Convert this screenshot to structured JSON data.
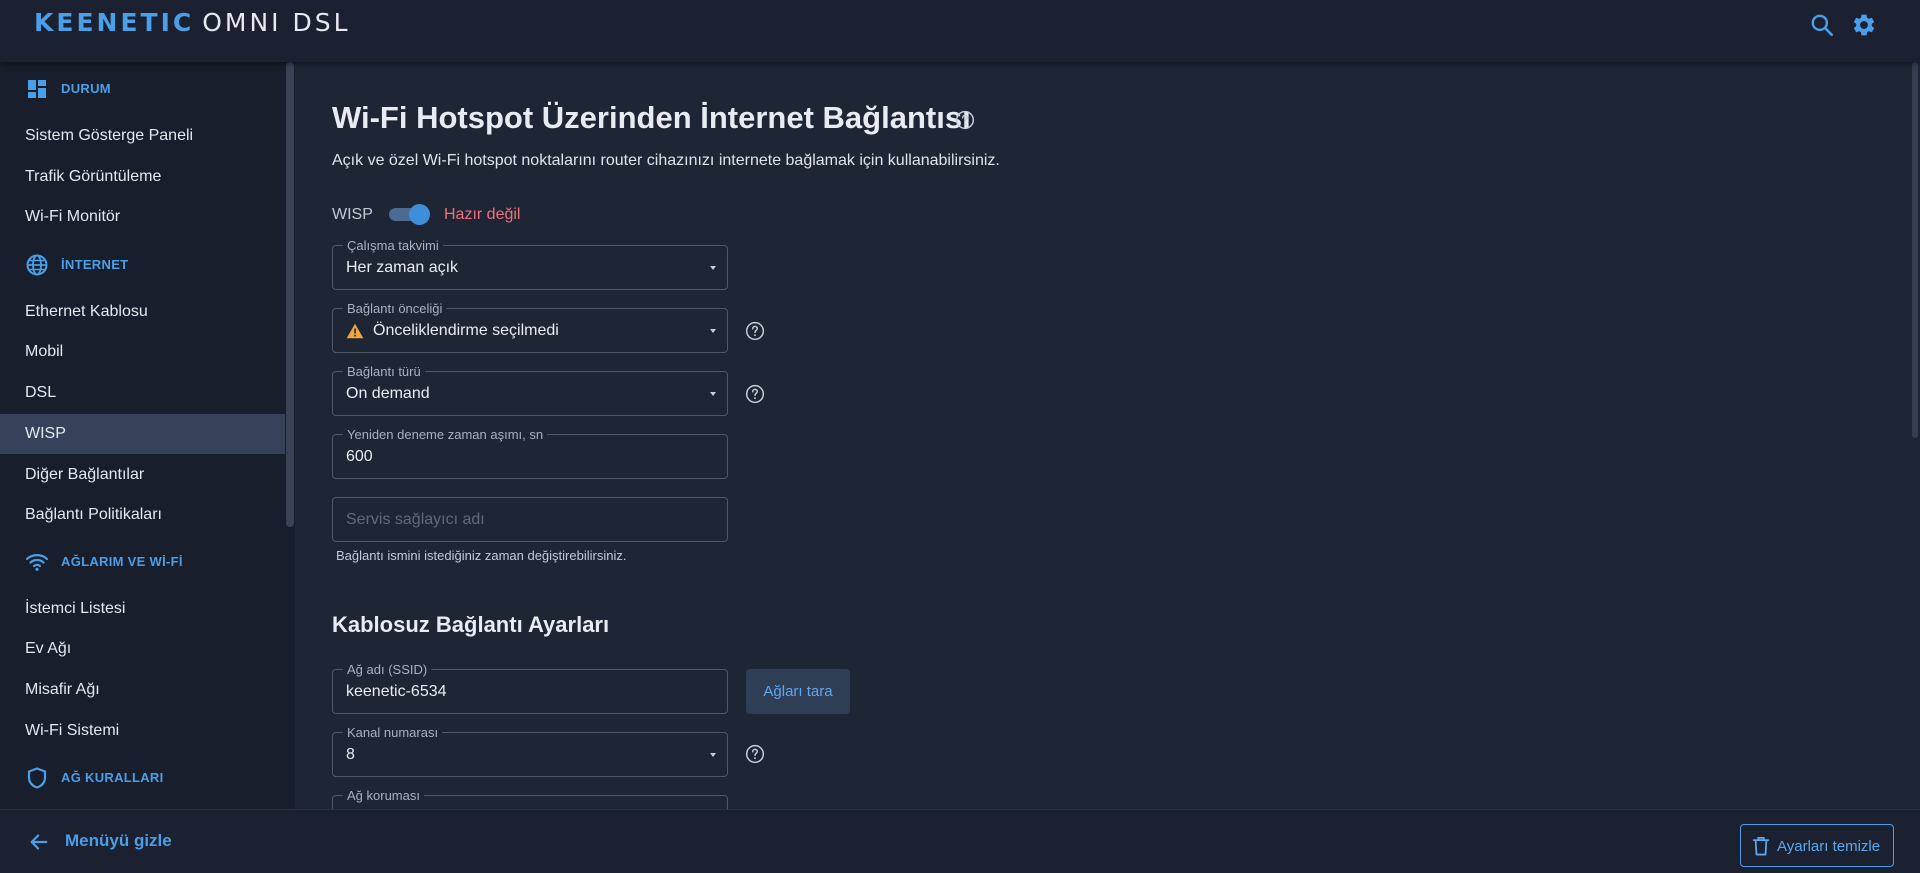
{
  "header": {
    "brand_primary": "KEENETIC",
    "brand_secondary": "OMNI DSL",
    "icons": [
      "search-icon",
      "gear-icon"
    ],
    "accent_color": "#4a9fe8"
  },
  "sidebar": {
    "sections": [
      {
        "label": "DURUM",
        "icon": "dashboard-icon"
      },
      {
        "label": "İNTERNET",
        "icon": "globe-icon"
      },
      {
        "label": "AĞLARIM VE Wİ-Fİ",
        "icon": "wifi-icon"
      },
      {
        "label": "AĞ KURALLARI",
        "icon": "shield-icon"
      }
    ],
    "items": [
      {
        "label": "Sistem Gösterge Paneli"
      },
      {
        "label": "Trafik Görüntüleme"
      },
      {
        "label": "Wi-Fi Monitör"
      },
      {
        "label": "Ethernet Kablosu"
      },
      {
        "label": "Mobil"
      },
      {
        "label": "DSL"
      },
      {
        "label": "WISP",
        "active": true
      },
      {
        "label": "Diğer Bağlantılar"
      },
      {
        "label": "Bağlantı Politikaları"
      },
      {
        "label": "İstemci Listesi"
      },
      {
        "label": "Ev Ağı"
      },
      {
        "label": "Misafir Ağı"
      },
      {
        "label": "Wi-Fi Sistemi"
      }
    ],
    "hide_menu_label": "Menüyü gizle"
  },
  "main": {
    "title": "Wi-Fi Hotspot Üzerinden İnternet Bağlantısı",
    "description": "Açık ve özel Wi-Fi hotspot noktalarını router cihazınızı internete bağlamak için kullanabilirsiniz.",
    "wisp_label": "WISP",
    "wisp_enabled": true,
    "status_text": "Hazır değil",
    "status_color": "#f0707a",
    "schedule": {
      "label": "Çalışma takvimi",
      "value": "Her zaman açık"
    },
    "priority": {
      "label": "Bağlantı önceliği",
      "value": "Önceliklendirme seçilmedi",
      "icon": "warning-icon"
    },
    "connection_type": {
      "label": "Bağlantı türü",
      "value": "On demand"
    },
    "retry_timeout": {
      "label": "Yeniden deneme zaman aşımı, sn",
      "value": "600"
    },
    "provider_name": {
      "placeholder": "Servis sağlayıcı adı",
      "value": ""
    },
    "provider_hint": "Bağlantı ismini istediğiniz zaman değiştirebilirsiniz.",
    "wireless_section_title": "Kablosuz Bağlantı Ayarları",
    "ssid": {
      "label": "Ağ adı (SSID)",
      "value": "keenetic-6534"
    },
    "scan_button": "Ağları tara",
    "channel": {
      "label": "Kanal numarası",
      "value": "8"
    },
    "security": {
      "label": "Ağ koruması"
    }
  },
  "footer": {
    "reset_label": "Ayarları temizle",
    "reset_icon": "trash-icon"
  }
}
